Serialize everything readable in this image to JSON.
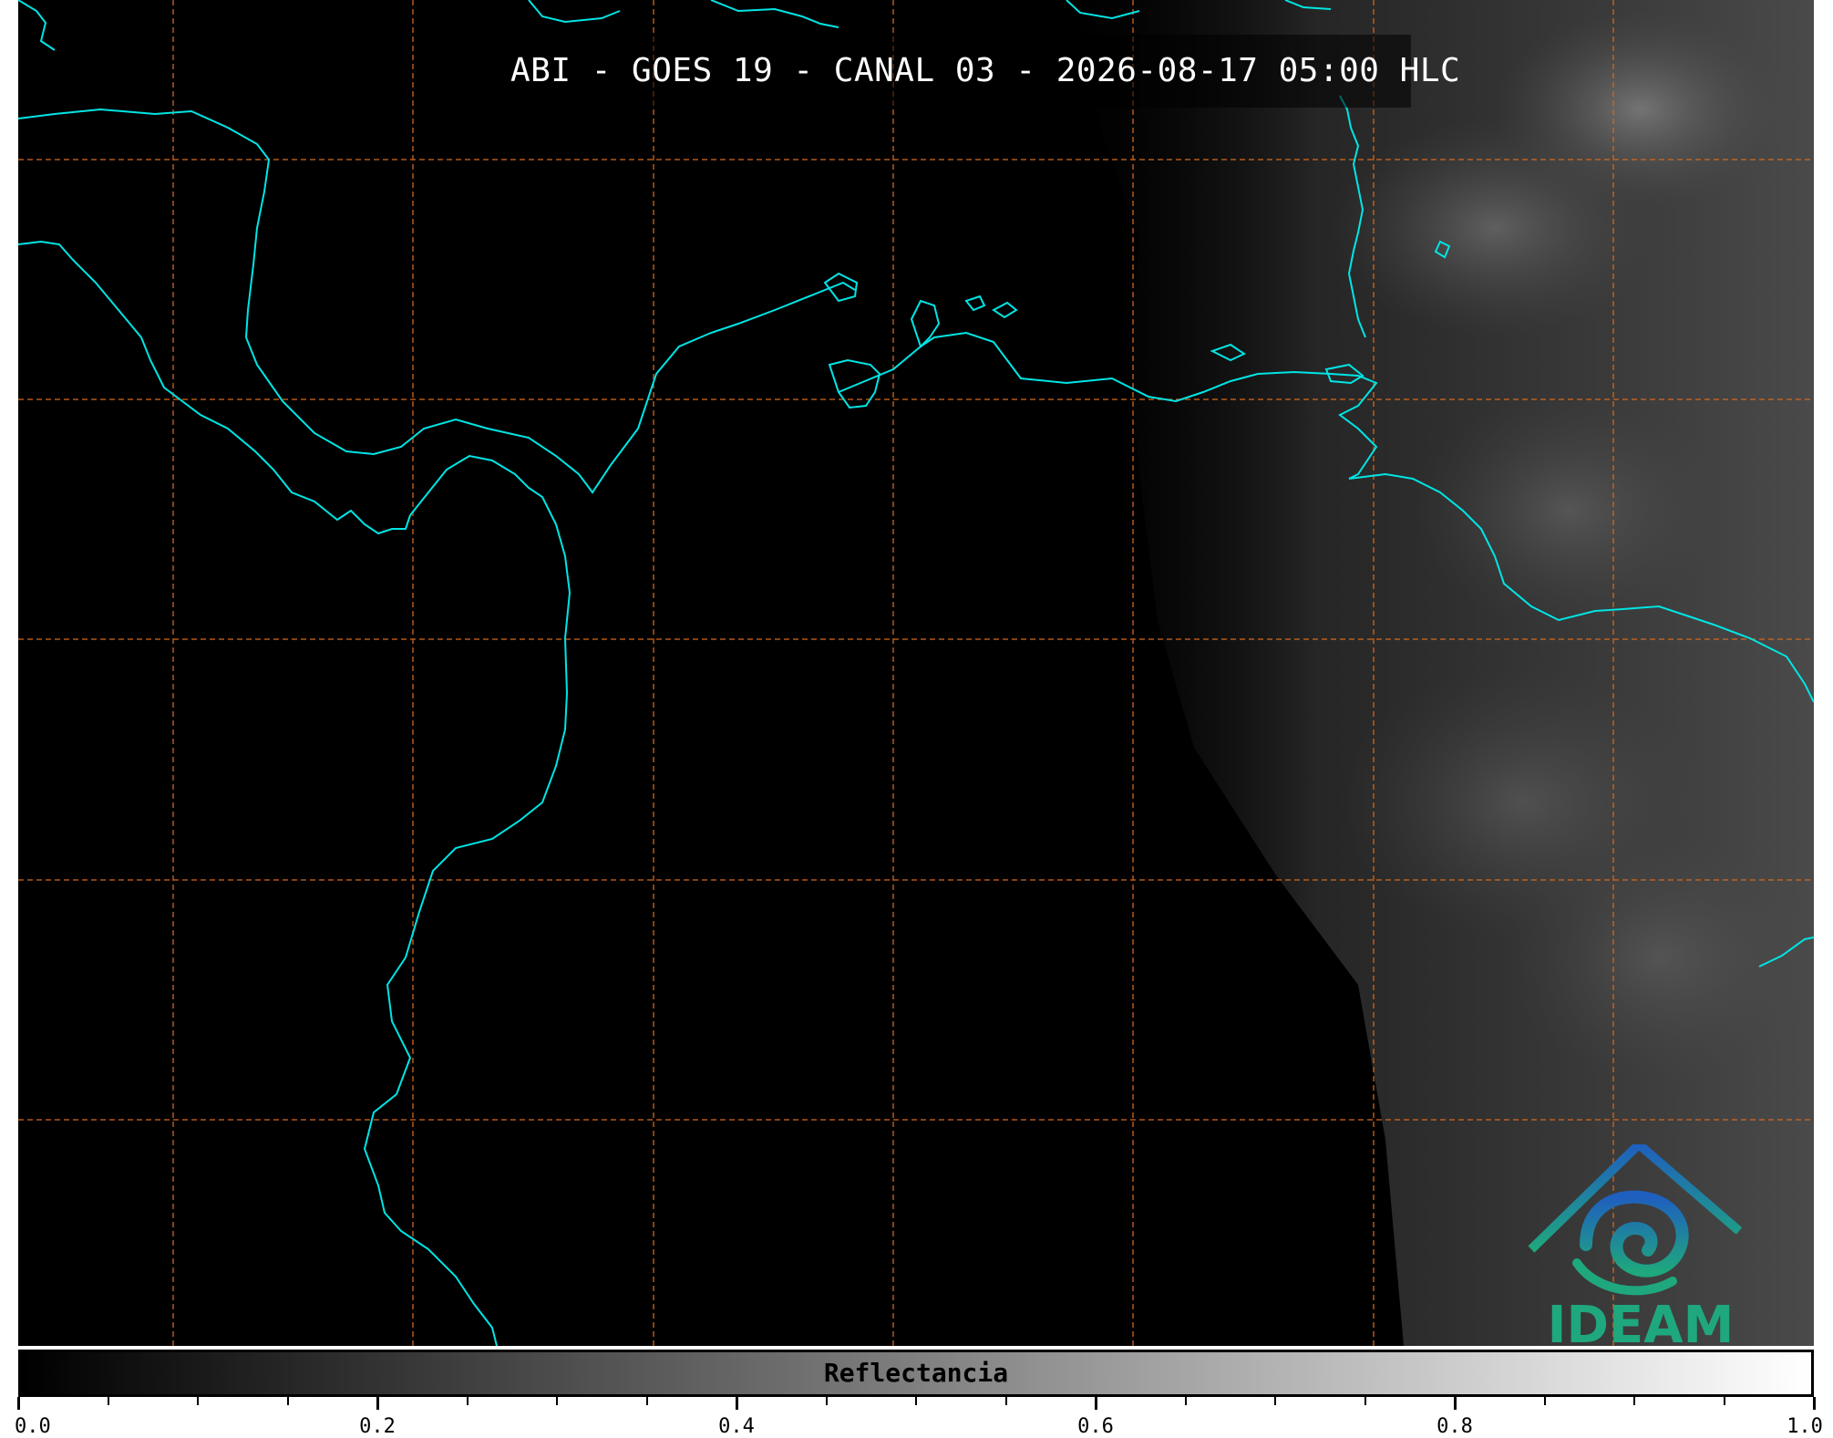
{
  "map": {
    "title": "ABI - GOES 19 - CANAL 03 - 2026-08-17 05:00 HLC",
    "coastline_color": "#00e5e5",
    "graticule_color": "#d2691e",
    "background_color": "#000000",
    "cloud_color": "#5a5a5a"
  },
  "logo": {
    "text": "IDEAM",
    "icon": "ideam-logo-icon",
    "colors": [
      "#1f5fbf",
      "#1fa77e"
    ]
  },
  "colorbar": {
    "label": "Reflectancia",
    "min": 0.0,
    "max": 1.0,
    "tick_labels": [
      "0.0",
      "0.2",
      "0.4",
      "0.6",
      "0.8",
      "1.0"
    ],
    "minor_tick_step": 0.05,
    "gradient": [
      "#000000",
      "#ffffff"
    ]
  }
}
